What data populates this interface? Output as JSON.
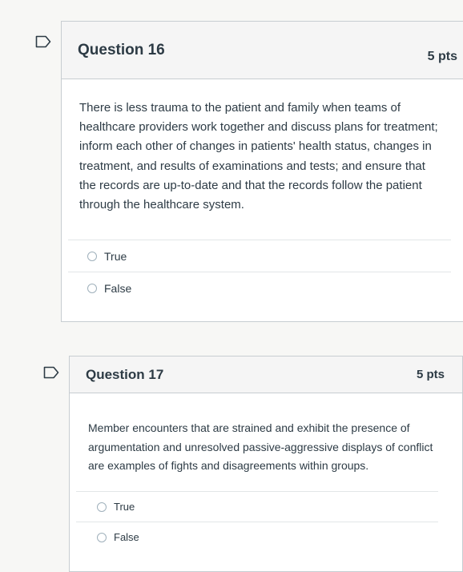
{
  "colors": {
    "text": "#2d3b45",
    "border": "#c7cdd1",
    "header_bg": "#f5f5f5",
    "flag_outline": "#2d3b45"
  },
  "questions": [
    {
      "title": "Question 16",
      "points": "5 pts",
      "text": "There is less trauma to the patient and family when teams of healthcare providers work together and discuss plans for treatment; inform each other of changes in patients' health status, changes in treatment, and results of examinations and tests; and ensure that the records are up-to-date and that the records follow the patient through the healthcare system.",
      "answers": [
        "True",
        "False"
      ],
      "flag_icon": "flag-question-icon"
    },
    {
      "title": "Question 17",
      "points": "5 pts",
      "text": "Member encounters that are strained and exhibit the presence of argumentation and unresolved passive-aggressive displays of conflict are examples of fights and disagreements within groups.",
      "answers": [
        "True",
        "False"
      ],
      "flag_icon": "flag-question-icon"
    }
  ]
}
